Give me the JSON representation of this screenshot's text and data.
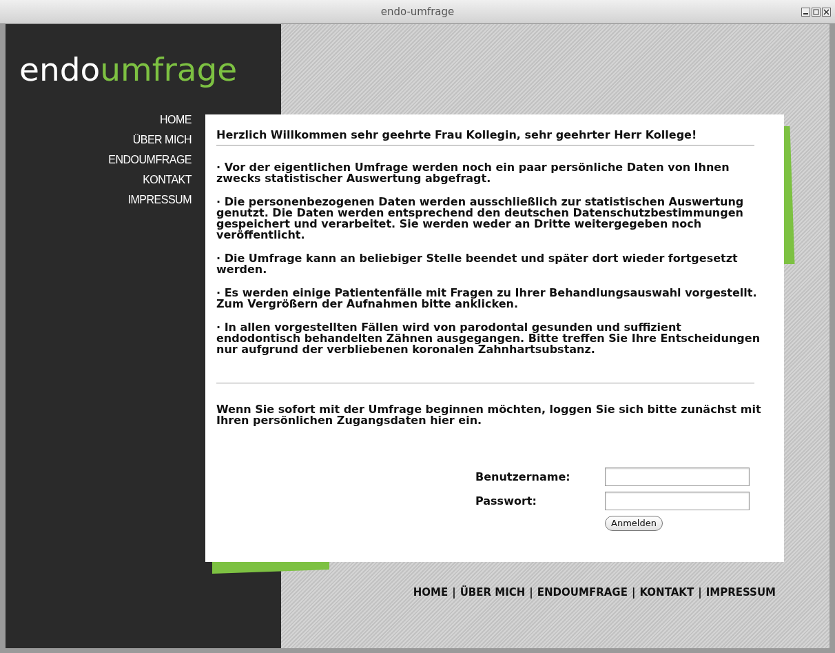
{
  "window": {
    "title": "endo-umfrage"
  },
  "logo": {
    "prefix": "endo",
    "suffix": "umfrage"
  },
  "sidebar": {
    "items": [
      {
        "label": "HOME"
      },
      {
        "label": "ÜBER MICH"
      },
      {
        "label": "ENDOUMFRAGE"
      },
      {
        "label": "KONTAKT"
      },
      {
        "label": "IMPRESSUM"
      }
    ]
  },
  "content": {
    "heading": "Herzlich Willkommen sehr geehrte Frau Kollegin, sehr geehrter Herr Kollege!",
    "paragraphs": [
      "· Vor der eigentlichen Umfrage werden noch ein paar persönliche Daten von Ihnen zwecks statistischer Auswertung abgefragt.",
      "· Die personenbezogenen Daten werden ausschließlich zur statistischen Auswertung genutzt. Die Daten werden entsprechend den deutschen Datenschutzbestimmungen gespeichert und verarbeitet. Sie werden weder an Dritte weitergegeben noch veröffentlicht.",
      "· Die Umfrage kann an beliebiger Stelle beendet und später dort wieder fortgesetzt werden.",
      "· Es werden einige Patientenfälle mit Fragen zu Ihrer Behandlungsauswahl vorgestellt. Zum Vergrößern der Aufnahmen bitte anklicken.",
      "· In allen vorgestellten Fällen wird von parodontal gesunden und suffizient endodontisch behandelten Zähnen ausgegangen. Bitte treffen Sie Ihre Entscheidungen nur aufgrund der verbliebenen koronalen Zahnhartsubstanz."
    ],
    "login_intro": "Wenn Sie sofort mit der Umfrage beginnen möchten, loggen Sie sich bitte zunächst mit Ihren persönlichen Zugangsdaten hier ein.",
    "login": {
      "fields": [
        {
          "label": "Benutzername:"
        },
        {
          "label": "Passwort:"
        }
      ],
      "button": "Anmelden"
    }
  },
  "footer": {
    "separator": "|",
    "links": [
      "HOME",
      "ÜBER MICH",
      "ENDOUMFRAGE",
      "KONTAKT",
      "IMPRESSUM"
    ]
  }
}
